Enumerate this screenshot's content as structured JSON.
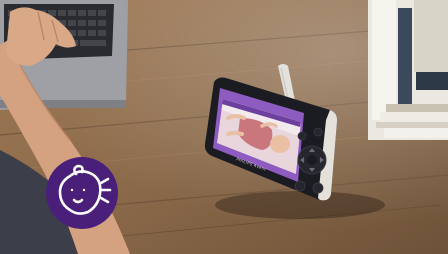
{
  "photo": {
    "subject": "baby-monitor-on-wooden-table",
    "colors": {
      "table": "#8a6a48",
      "table_dark": "#5f4631",
      "device_bezel": "#1b1b22",
      "device_screen_frame": "#8e5cc1",
      "badge": "#4a1f7a",
      "badge_icon": "#ffffff"
    }
  },
  "device": {
    "brand_text": "PHILIPS   Avent"
  },
  "badge": {
    "icon": "baby-breathing-icon"
  }
}
